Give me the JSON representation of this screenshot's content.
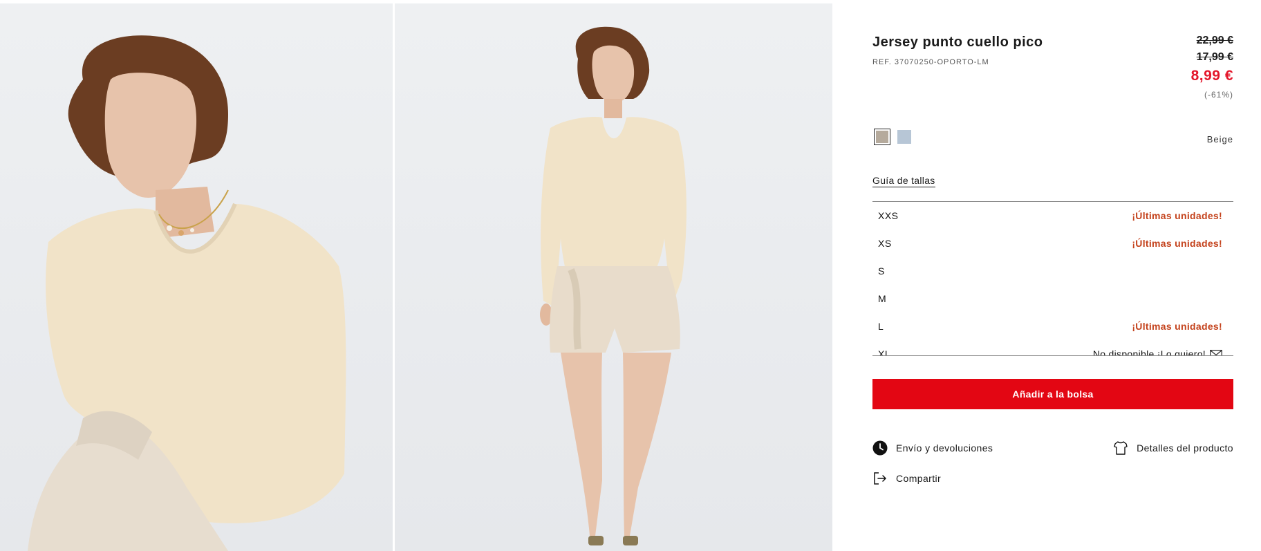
{
  "product": {
    "title": "Jersey punto cuello pico",
    "reference": "REF. 37070250-OPORTO-LM",
    "price_original": "22,99 €",
    "price_previous": "17,99 €",
    "price_current": "8,99 €",
    "discount": "(-61%)",
    "color_selected": "Beige",
    "colors": [
      {
        "name": "beige",
        "hex": "#b5aa9c"
      },
      {
        "name": "blue",
        "hex": "#b7c6d6"
      }
    ]
  },
  "size_guide_label": "Guía de tallas",
  "sizes": [
    {
      "label": "XXS",
      "status": "¡Últimas unidades!"
    },
    {
      "label": "XS",
      "status": "¡Últimas unidades!"
    },
    {
      "label": "S",
      "status": ""
    },
    {
      "label": "M",
      "status": ""
    },
    {
      "label": "L",
      "status": "¡Últimas unidades!"
    },
    {
      "label": "XL",
      "status": "No disponible ¡Lo quiero!"
    }
  ],
  "actions": {
    "add_to_bag": "Añadir a la bolsa",
    "shipping": "Envío y devoluciones",
    "details": "Detalles del producto",
    "share": "Compartir"
  },
  "colors": {
    "accent_red": "#e30613",
    "sale_price": "#e4172b",
    "low_stock": "#c4421c"
  },
  "icons": [
    "clock-icon",
    "tshirt-icon",
    "share-icon",
    "envelope-icon"
  ]
}
